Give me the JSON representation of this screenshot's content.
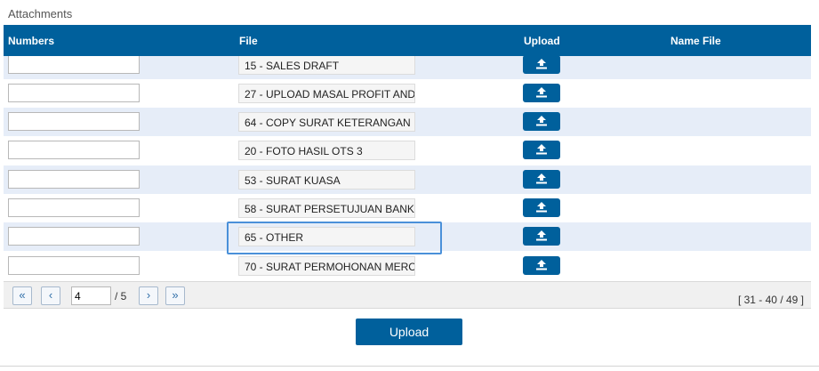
{
  "section_title": "Attachments",
  "columns": {
    "numbers": "Numbers",
    "file": "File",
    "upload": "Upload",
    "name_file": "Name File"
  },
  "rows": [
    {
      "number": "",
      "file": "15 - SALES DRAFT",
      "name_file": ""
    },
    {
      "number": "",
      "file": "27 - UPLOAD MASAL PROFIT AND",
      "name_file": ""
    },
    {
      "number": "",
      "file": "64 - COPY SURAT KETERANGAN",
      "name_file": ""
    },
    {
      "number": "",
      "file": "20 - FOTO HASIL OTS 3",
      "name_file": ""
    },
    {
      "number": "",
      "file": "53 - SURAT KUASA",
      "name_file": ""
    },
    {
      "number": "",
      "file": "58 - SURAT PERSETUJUAN BANK",
      "name_file": ""
    },
    {
      "number": "",
      "file": "65 - OTHER",
      "name_file": ""
    },
    {
      "number": "",
      "file": "70 - SURAT PERMOHONAN MERC",
      "name_file": ""
    }
  ],
  "pager": {
    "first": "«",
    "prev": "‹",
    "next": "›",
    "last": "»",
    "current_page": "4",
    "total_pages": "/ 5",
    "range_info": "[ 31 - 40 / 49 ]"
  },
  "upload_button_label": "Upload",
  "icons": {
    "row_upload": "upload-icon"
  },
  "colors": {
    "header": "#00609c",
    "alt_row": "#e6edf8",
    "highlight": "#4a90d9"
  }
}
